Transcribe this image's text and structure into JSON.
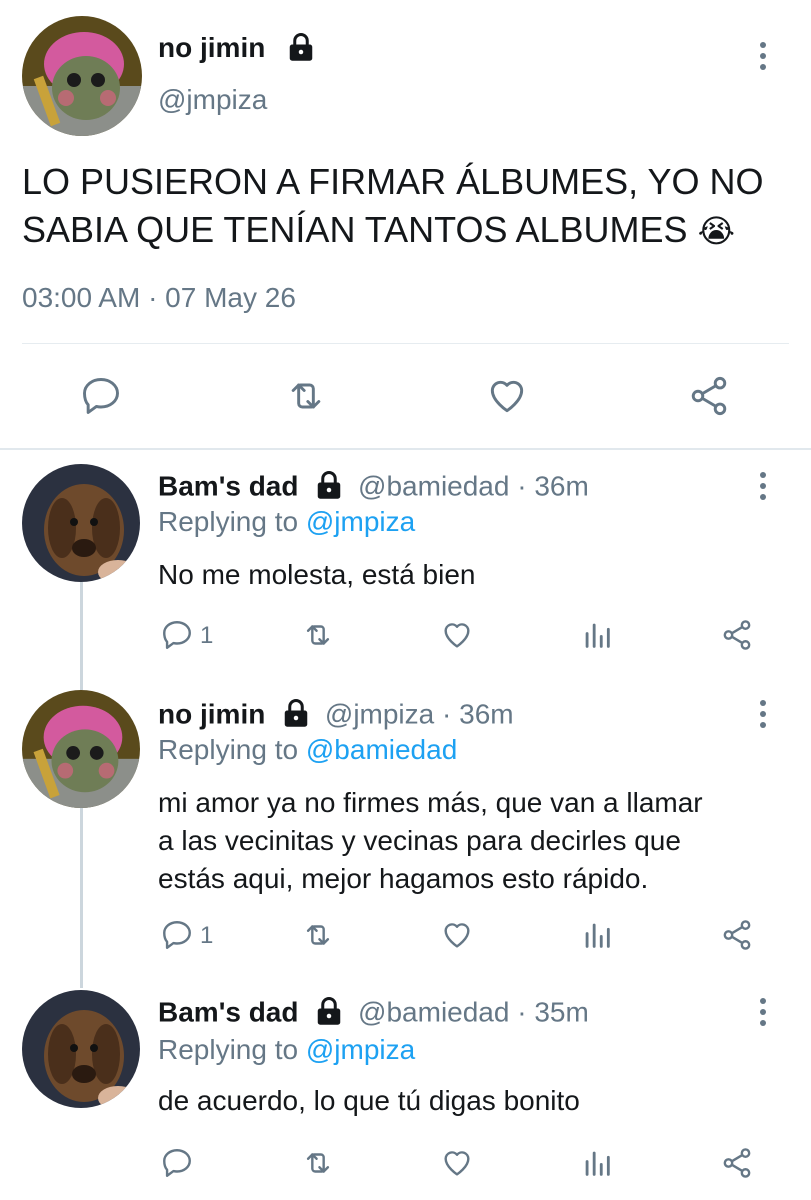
{
  "main_tweet": {
    "display_name": "no jimin",
    "handle": "@jmpiza",
    "text_line1": "LO PUSIERON A FIRMAR ÁLBUMES, YO NO",
    "text_line2": "SABIA QUE TENÍAN TANTOS ALBUMES",
    "emoji": "😭",
    "timestamp": "03:00 AM · 07 May 26",
    "actions": [
      "reply-icon",
      "retweet-icon",
      "like-icon",
      "share-icon"
    ]
  },
  "replies": [
    {
      "display_name": "Bam's dad",
      "handle": "@bamiedad",
      "time": "· 36m",
      "replying_prefix": "Replying to",
      "replying_to": "@jmpiza",
      "text_lines": [
        "No me molesta, está bien"
      ],
      "reply_count": "1"
    },
    {
      "display_name": "no jimin",
      "handle": "@jmpiza",
      "time": "· 36m",
      "replying_prefix": "Replying to",
      "replying_to": "@bamiedad",
      "text_lines": [
        "mi amor ya no firmes más, que van a llamar",
        "a las vecinitas y vecinas para decirles que",
        "estás aqui, mejor hagamos esto rápido."
      ],
      "reply_count": "1"
    },
    {
      "display_name": "Bam's dad",
      "handle": "@bamiedad",
      "time": "· 35m",
      "replying_prefix": "Replying to",
      "replying_to": "@jmpiza",
      "text_lines": [
        "de acuerdo, lo que tú digas bonito"
      ],
      "reply_count": ""
    }
  ],
  "colors": {
    "link": "#1da1f2",
    "secondary_text": "#657786",
    "divider": "#e6ecf0",
    "thread_line": "#ccd6dd"
  }
}
